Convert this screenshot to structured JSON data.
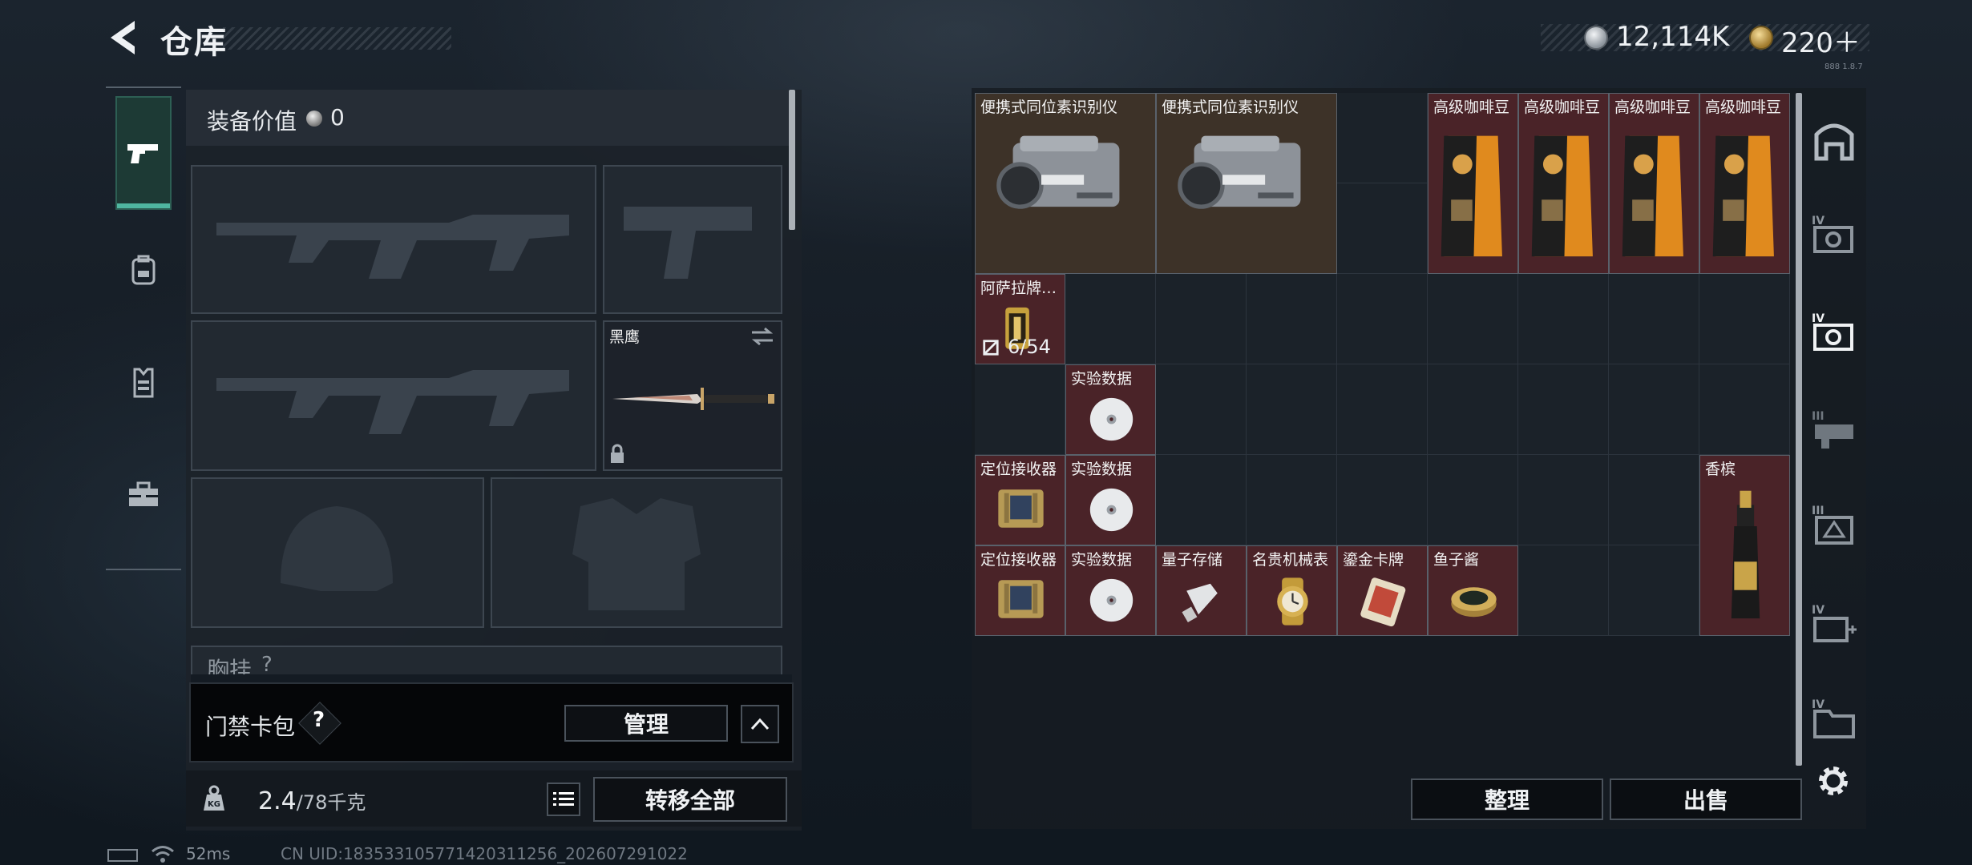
{
  "header": {
    "title": "仓库"
  },
  "currency": {
    "silver": "12,114K",
    "gold": "220＋",
    "version": "888 1.8.7"
  },
  "rail": {
    "items": [
      "pistol-icon",
      "backpack-icon",
      "vest-icon",
      "toolbox-icon"
    ]
  },
  "equipment": {
    "value_label": "装备价值",
    "value": "0",
    "knife_name": "黑鹰",
    "chest_label": "胸挂",
    "chest_help": "?"
  },
  "access_card": {
    "label": "门禁卡包",
    "help": "?",
    "manage": "管理",
    "collapse": "^"
  },
  "weight": {
    "value": "2.4",
    "capacity": "/78千克",
    "transfer_all": "转移全部"
  },
  "status": {
    "ping": "52ms",
    "uid": "CN UID:18353310577142031125­6_202607291022"
  },
  "storage": {
    "items": [
      {
        "name": "便携式同位素识别仪",
        "rarity": "brown"
      },
      {
        "name": "便携式同位素识别仪",
        "rarity": "brown"
      },
      {
        "name": "高级咖啡豆",
        "rarity": "red"
      },
      {
        "name": "高级咖啡豆",
        "rarity": "red"
      },
      {
        "name": "高级咖啡豆",
        "rarity": "red"
      },
      {
        "name": "高级咖啡豆",
        "rarity": "red"
      },
      {
        "name": "阿萨拉牌…",
        "rarity": "red",
        "stack": "6/54"
      },
      {
        "name": "实验数据",
        "rarity": "red"
      },
      {
        "name": "定位接收器",
        "rarity": "red"
      },
      {
        "name": "实验数据",
        "rarity": "red"
      },
      {
        "name": "香槟",
        "rarity": "red"
      },
      {
        "name": "定位接收器",
        "rarity": "red"
      },
      {
        "name": "实验数据",
        "rarity": "red"
      },
      {
        "name": "量子存储",
        "rarity": "red"
      },
      {
        "name": "名贵机械表",
        "rarity": "red"
      },
      {
        "name": "鎏金卡牌",
        "rarity": "red"
      },
      {
        "name": "鱼子酱",
        "rarity": "red"
      }
    ],
    "tidy": "整理",
    "sell": "出售"
  },
  "colors": {
    "accent": "#4fb6a0",
    "red_rarity": "#4a2328",
    "brown_rarity": "#3d3228"
  }
}
